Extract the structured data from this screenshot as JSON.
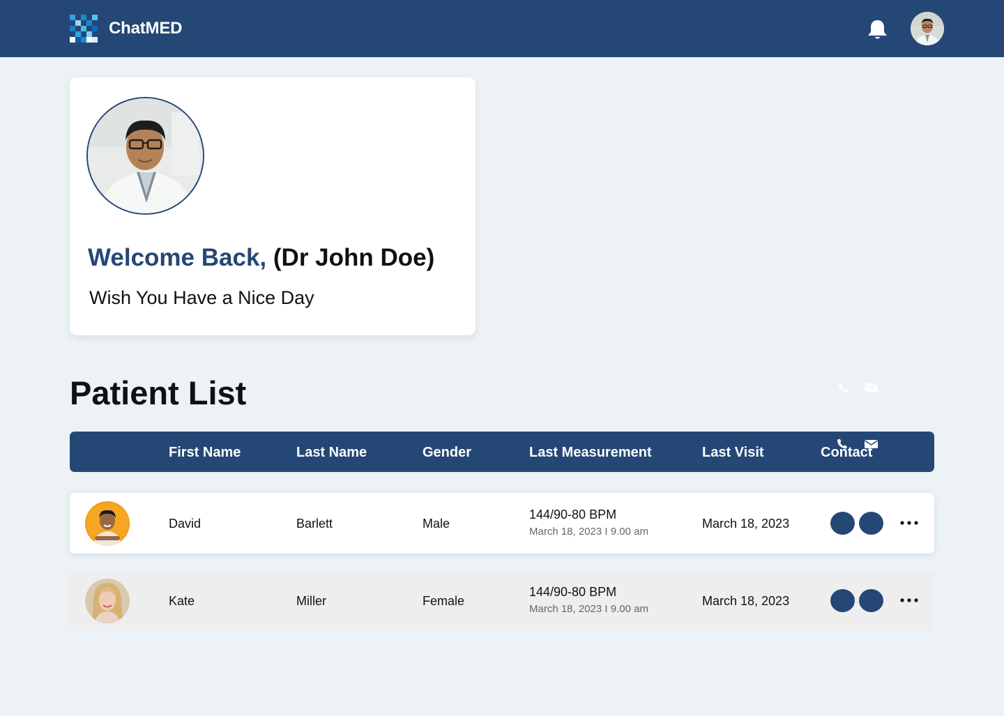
{
  "app": {
    "brand": "ChatMED",
    "colors": {
      "primary": "#244775",
      "background": "#ecf2f5",
      "row_alt": "#eeeeee",
      "accent": "#1a8ad0"
    }
  },
  "header": {
    "logo_icon": "checker-logo",
    "notification_icon": "bell-icon",
    "profile_icon": "avatar-doctor"
  },
  "welcome": {
    "greeting": "Welcome Back,",
    "name": "(Dr John Doe)",
    "subtitle": "Wish You Have a Nice Day"
  },
  "patients": {
    "title": "Patient List",
    "columns": {
      "first_name": "First Name",
      "last_name": "Last Name",
      "gender": "Gender",
      "last_measurement": "Last Measurement",
      "last_visit": "Last Visit",
      "contact": "Contact"
    },
    "rows": [
      {
        "first_name": "David",
        "last_name": "Barlett",
        "gender": "Male",
        "measurement": "144/90-80 BPM",
        "measurement_time": "March 18, 2023 I 9.00 am",
        "last_visit": "March 18, 2023",
        "avatar": "avatar-male-orange"
      },
      {
        "first_name": "Kate",
        "last_name": "Miller",
        "gender": "Female",
        "measurement": "144/90-80 BPM",
        "measurement_time": "March 18, 2023 I 9.00 am",
        "last_visit": "March 18, 2023",
        "avatar": "avatar-female-blonde"
      }
    ],
    "row_icons": [
      "phone-icon",
      "mail-icon",
      "more-icon"
    ]
  }
}
